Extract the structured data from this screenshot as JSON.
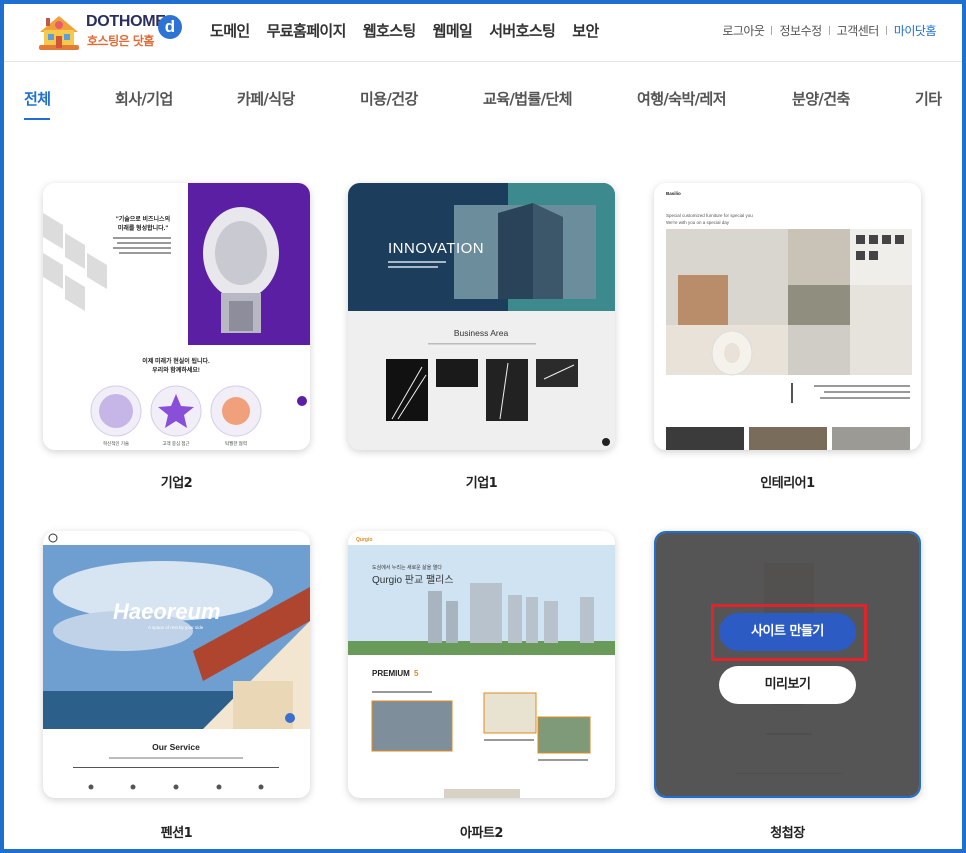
{
  "header": {
    "logo": {
      "brand": "DOTHOME",
      "tagline": "호스팅은 닷홈",
      "badge": "d"
    },
    "nav": [
      "도메인",
      "무료홈페이지",
      "웹호스팅",
      "웹메일",
      "서버호스팅",
      "보안"
    ],
    "util": {
      "logout": "로그아웃",
      "edit_info": "정보수정",
      "support": "고객센터",
      "my_dothome": "마이닷홈"
    }
  },
  "categories": [
    {
      "label": "전체",
      "active": true
    },
    {
      "label": "회사/기업",
      "active": false
    },
    {
      "label": "카페/식당",
      "active": false
    },
    {
      "label": "미용/건강",
      "active": false
    },
    {
      "label": "교육/법률/단체",
      "active": false
    },
    {
      "label": "여행/숙박/레저",
      "active": false
    },
    {
      "label": "분양/건축",
      "active": false
    },
    {
      "label": "기타",
      "active": false
    }
  ],
  "templates": [
    {
      "title": "기업2",
      "thumb": {
        "quote_line1": "\"기술으로 비즈니스의",
        "quote_line2": "미래를 형성합니다.\"",
        "headline_line1": "이제 미래가 현실이 됩니다.",
        "headline_line2": "우리와 함께하세요!",
        "circle_labels": [
          "혁신적인 기술",
          "고객 중심 접근",
          "탁월한 협력"
        ]
      }
    },
    {
      "title": "기업1",
      "thumb": {
        "hero": "INNOVATION",
        "section": "Business Area"
      }
    },
    {
      "title": "인테리어1",
      "thumb": {
        "logo": "Basilio",
        "line1": "Special customized furniture for special you",
        "line2": "We're with you on a special day"
      }
    },
    {
      "title": "펜션1",
      "thumb": {
        "hero": "Haeoreum",
        "sub": "A space of rest by your side",
        "section": "Our Service"
      }
    },
    {
      "title": "아파트2",
      "thumb": {
        "logo": "Qurgio",
        "kicker": "도심에서 누리는 새로운 삶을 열다",
        "hero": "Qurgio 판교 팰리스",
        "section": "PREMIUM",
        "section_num": "5"
      }
    },
    {
      "title": "청첩장",
      "hovered": true,
      "actions": {
        "make": "사이트 만들기",
        "preview": "미리보기"
      }
    }
  ],
  "colors": {
    "accent": "#1f6fd0",
    "make_button": "#2c5bc4",
    "highlight_box": "#e0242b",
    "purple": "#5a1fa3",
    "teal": "#2c7380"
  }
}
